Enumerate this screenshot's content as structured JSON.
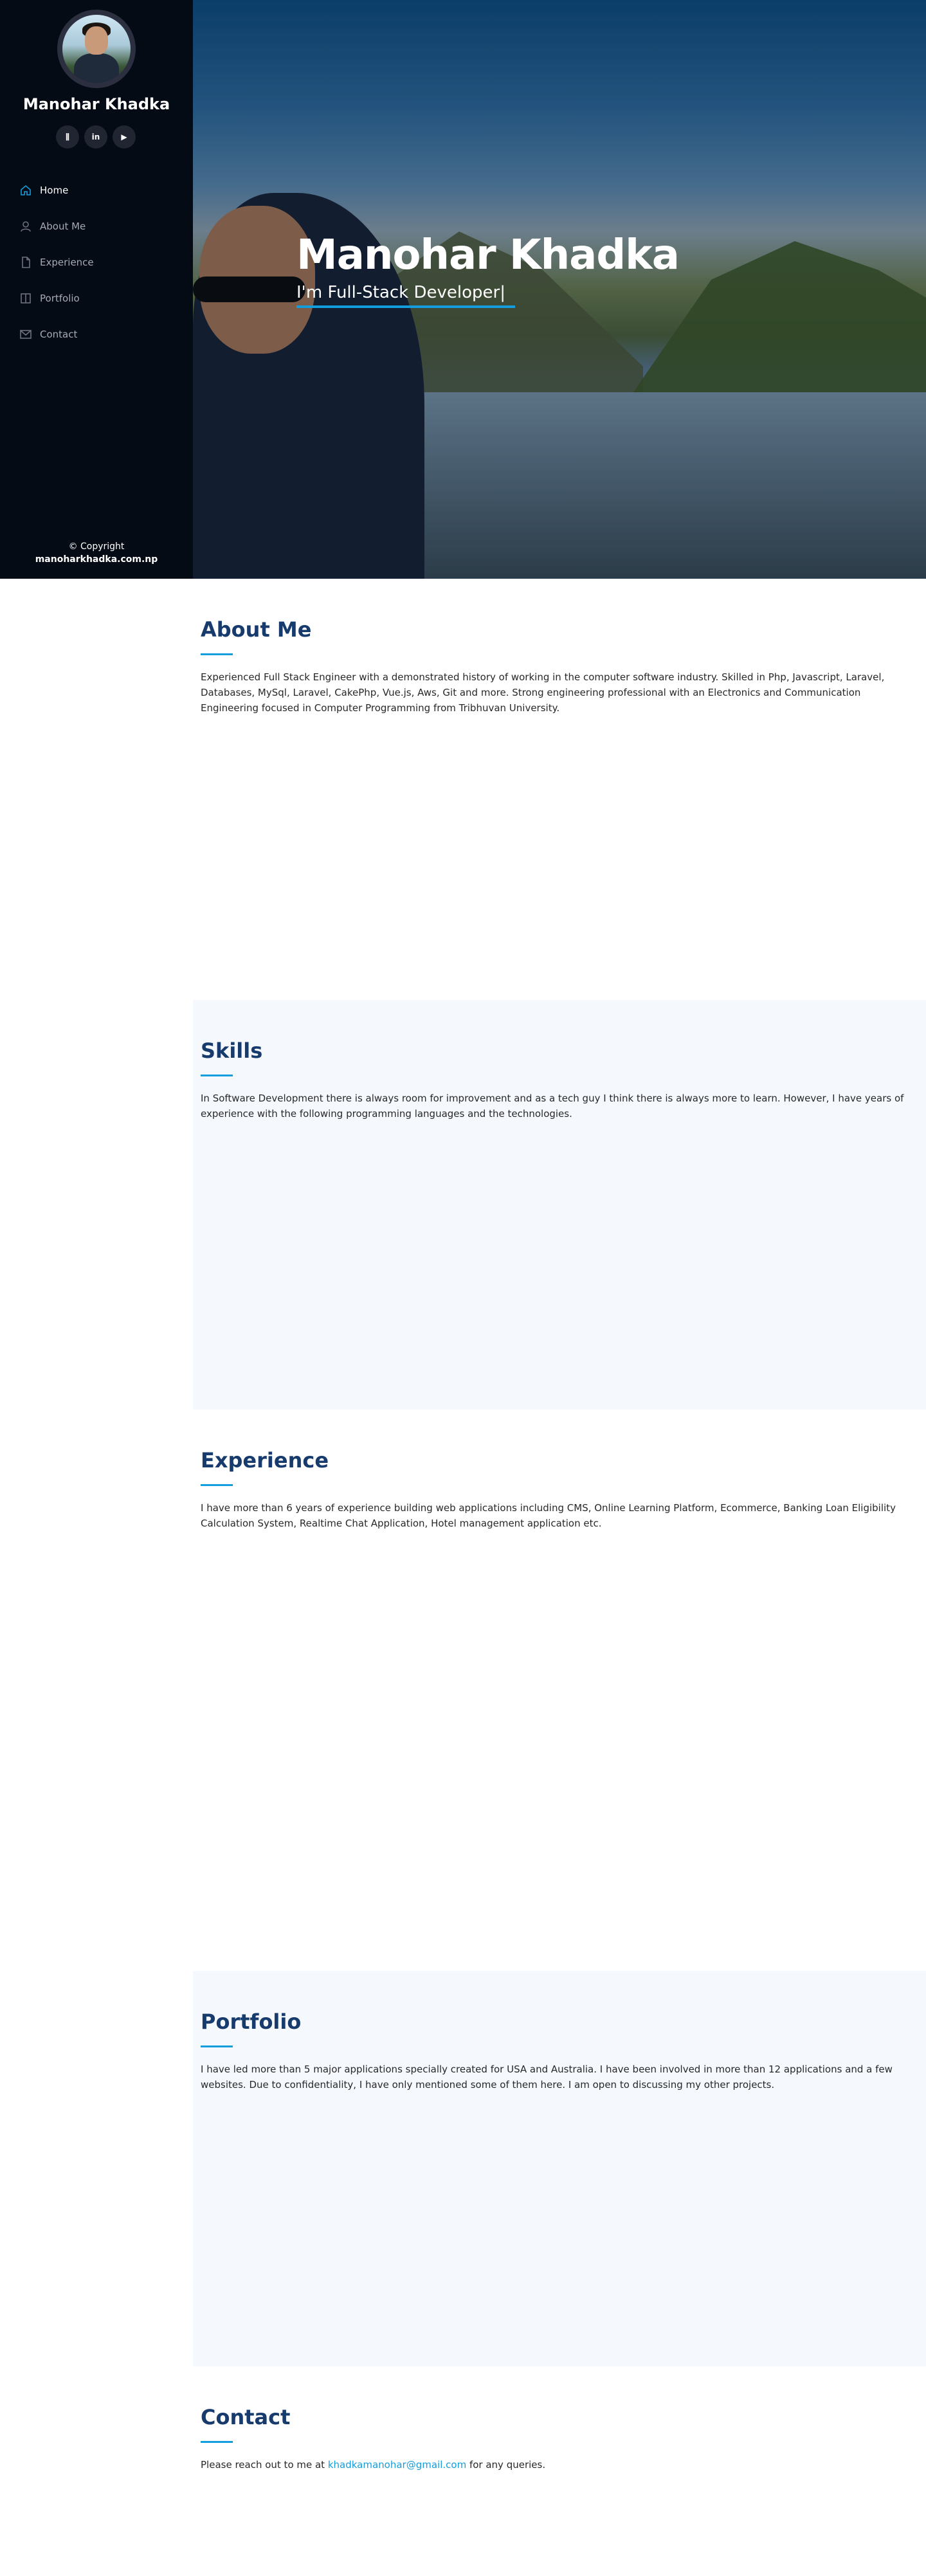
{
  "sidebar": {
    "name": "Manohar Khadka",
    "social": [
      {
        "icon": "stackoverflow-icon",
        "glyph": "⫼"
      },
      {
        "icon": "linkedin-icon",
        "glyph": "in"
      },
      {
        "icon": "youtube-icon",
        "glyph": "▶"
      }
    ],
    "nav": [
      {
        "label": "Home",
        "icon": "home-icon",
        "active": true
      },
      {
        "label": "About Me",
        "icon": "user-icon",
        "active": false
      },
      {
        "label": "Experience",
        "icon": "file-icon",
        "active": false
      },
      {
        "label": "Portfolio",
        "icon": "book-icon",
        "active": false
      },
      {
        "label": "Contact",
        "icon": "envelope-icon",
        "active": false
      }
    ],
    "copyright_line1": "© Copyright",
    "copyright_line2": "manoharkhadka.com.np"
  },
  "hero": {
    "title": "Manohar Khadka",
    "subtitle": "I'm Full-Stack Developer|"
  },
  "about": {
    "title": "About Me",
    "text": "Experienced Full Stack Engineer with a demonstrated history of working in the computer software industry. Skilled in Php, Javascript, Laravel, Databases, MySql, Laravel, CakePhp, Vue.js, Aws, Git and more. Strong engineering professional with an Electronics and Communication Engineering focused in Computer Programming from Tribhuvan University."
  },
  "skills": {
    "title": "Skills",
    "text": "In Software Development there is always room for improvement and as a tech guy I think there is always more to learn. However, I have years of experience with the following programming languages and the technologies."
  },
  "experience": {
    "title": "Experience",
    "text": "I have more than 6 years of experience building web applications including CMS, Online Learning Platform, Ecommerce, Banking Loan Eligibility Calculation System, Realtime Chat Application, Hotel management application etc."
  },
  "portfolio": {
    "title": "Portfolio",
    "text": "I have led more than 5 major applications specially created for USA and Australia. I have been involved in more than 12 applications and a few websites. Due to confidentiality, I have only mentioned some of them here. I am open to discussing my other projects."
  },
  "contact": {
    "title": "Contact",
    "text_before": "Please reach out to me at ",
    "email": "khadkamanohar@gmail.com",
    "text_after": " for any queries."
  },
  "colors": {
    "accent": "#149ddd",
    "heading": "#173b6c",
    "sidebar_bg": "#040b14"
  }
}
